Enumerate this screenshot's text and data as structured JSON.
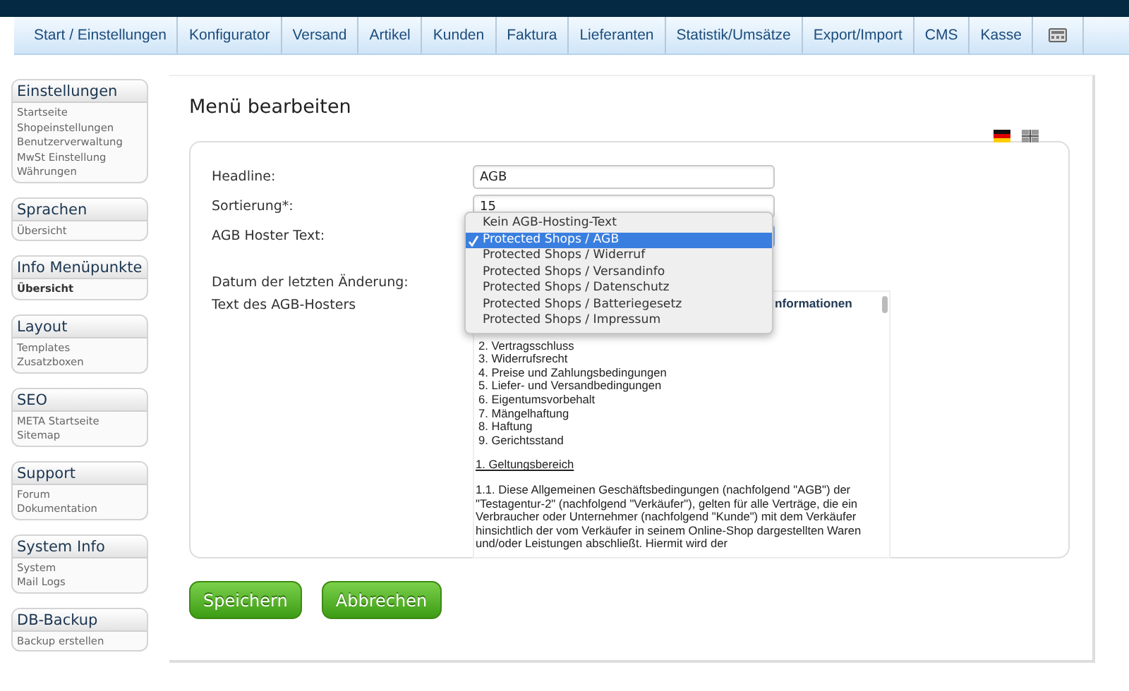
{
  "nav": [
    {
      "kind": "text",
      "label": "Start / Einstellungen"
    },
    {
      "kind": "text",
      "label": "Konfigurator"
    },
    {
      "kind": "text",
      "label": "Versand"
    },
    {
      "kind": "text",
      "label": "Artikel"
    },
    {
      "kind": "text",
      "label": "Kunden"
    },
    {
      "kind": "text",
      "label": "Faktura"
    },
    {
      "kind": "text",
      "label": "Lieferanten"
    },
    {
      "kind": "text",
      "label": "Statistik/Umsätze"
    },
    {
      "kind": "text",
      "label": "Export/Import"
    },
    {
      "kind": "text",
      "label": "CMS"
    },
    {
      "kind": "text",
      "label": "Kasse"
    },
    {
      "kind": "icon"
    }
  ],
  "sidebar": [
    {
      "title": "Einstellungen",
      "items": [
        {
          "label": "Startseite",
          "selected": false
        },
        {
          "label": "Shopeinstellungen",
          "selected": false
        },
        {
          "label": "Benutzerverwaltung",
          "selected": false
        },
        {
          "label": "MwSt Einstellung",
          "selected": false
        },
        {
          "label": "Währungen",
          "selected": false
        }
      ]
    },
    {
      "title": "Sprachen",
      "items": [
        {
          "label": "Übersicht",
          "selected": false
        }
      ]
    },
    {
      "title": "Info Menüpunkte",
      "items": [
        {
          "label": "Übersicht",
          "selected": true
        }
      ]
    },
    {
      "title": "Layout",
      "items": [
        {
          "label": "Templates",
          "selected": false
        },
        {
          "label": "Zusatzboxen",
          "selected": false
        }
      ]
    },
    {
      "title": "SEO",
      "items": [
        {
          "label": "META Startseite",
          "selected": false
        },
        {
          "label": "Sitemap",
          "selected": false
        }
      ]
    },
    {
      "title": "Support",
      "items": [
        {
          "label": "Forum",
          "selected": false
        },
        {
          "label": "Dokumentation",
          "selected": false
        }
      ]
    },
    {
      "title": "System Info",
      "items": [
        {
          "label": "System",
          "selected": false
        },
        {
          "label": "Mail Logs",
          "selected": false
        }
      ]
    },
    {
      "title": "DB-Backup",
      "items": [
        {
          "label": "Backup erstellen",
          "selected": false
        }
      ]
    }
  ],
  "main": {
    "title": "Menü bearbeiten",
    "fields": [
      {
        "kind": "input",
        "label": "Headline:",
        "value": "AGB"
      },
      {
        "kind": "input",
        "label": "Sortierung*:",
        "value": "15"
      },
      {
        "kind": "select",
        "label": "AGB Hoster Text:",
        "expanded": true,
        "options": [
          {
            "label": "Kein AGB-Hosting-Text",
            "selected": false
          },
          {
            "label": "Protected Shops / AGB",
            "selected": true
          },
          {
            "label": "Protected Shops / Widerruf",
            "selected": false
          },
          {
            "label": "Protected Shops / Versandinfo",
            "selected": false
          },
          {
            "label": "Protected Shops / Datenschutz",
            "selected": false
          },
          {
            "label": "Protected Shops / Batteriegesetz",
            "selected": false
          },
          {
            "label": "Protected Shops / Impressum",
            "selected": false
          }
        ]
      },
      {
        "kind": "text",
        "label": "Datum der letzten Änderung:"
      },
      {
        "kind": "textarea",
        "label": "Text des AGB-Hosters",
        "lines": [
          {
            "kind": "heading",
            "text": "nformationen"
          },
          {
            "kind": "list",
            "text": "2. Vertragsschluss"
          },
          {
            "kind": "list",
            "text": "3. Widerrufsrecht"
          },
          {
            "kind": "list",
            "text": "4. Preise und Zahlungsbedingungen"
          },
          {
            "kind": "list",
            "text": "5. Liefer-  und Versandbedingungen"
          },
          {
            "kind": "list",
            "text": "6. Eigentumsvorbehalt"
          },
          {
            "kind": "list",
            "text": "7. Mängelhaftung"
          },
          {
            "kind": "list",
            "text": "8. Haftung"
          },
          {
            "kind": "list",
            "text": "9. Gerichtsstand"
          },
          {
            "kind": "section",
            "text": "1. Geltungsbereich"
          },
          {
            "kind": "paragraph",
            "text": "1.1. Diese Allgemeinen Geschäftsbedingungen (nachfolgend \"AGB\") der \"Testagentur-2\" (nachfolgend \"Verkäufer\"), gelten für alle Verträge, die ein Verbraucher oder Unternehmer (nachfolgend \"Kunde\") mit dem Verkäufer hinsichtlich der vom Verkäufer in seinem Online-Shop dargestellten Waren und/oder Leistungen abschließt. Hiermit wird der"
          }
        ]
      }
    ],
    "buttons": [
      "Speichern",
      "Abbrechen"
    ]
  }
}
